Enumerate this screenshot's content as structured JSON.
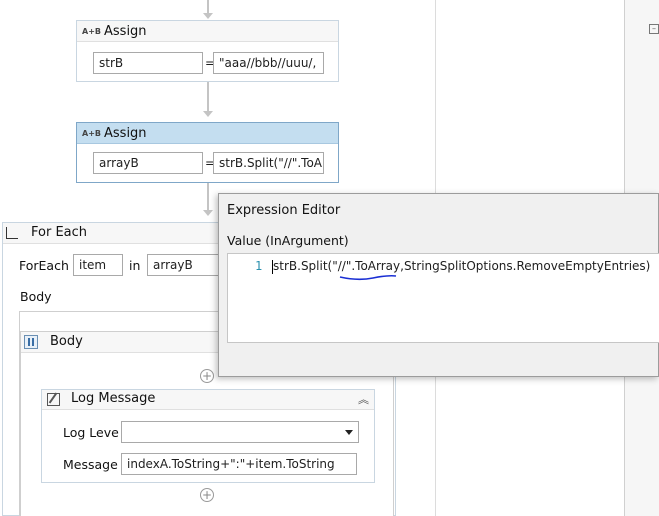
{
  "assign1": {
    "title": "Assign",
    "icon_text": "A+B",
    "to": "strB",
    "eq": "=",
    "value": "\"aaa//bbb//uuu/,"
  },
  "assign2": {
    "title": "Assign",
    "icon_text": "A+B",
    "to": "arrayB",
    "eq": "=",
    "value": "strB.Split(\"//\".ToA"
  },
  "foreach": {
    "title": "For Each",
    "foreach_label": "ForEach",
    "item": "item",
    "in_label": "in",
    "collection": "arrayB",
    "body_label": "Body"
  },
  "sequence": {
    "title": "Body"
  },
  "log": {
    "title": "Log Message",
    "level_label": "Log Leve",
    "level_value": "",
    "message_label": "Message",
    "message_value": "indexA.ToString+\":\"+item.ToString"
  },
  "expression_editor": {
    "title": "Expression Editor",
    "argument_label": "Value (InArgument)",
    "line_number": "1",
    "code_before": "strB.Split(\"",
    "code_underlined": "//\".ToArray",
    "code_after": ",StringSplitOptions.RemoveEmptyEntries)"
  },
  "colors": {
    "accent_selected": "#c4def0",
    "underline": "#1a2fd4",
    "line_number": "#2b91af"
  }
}
